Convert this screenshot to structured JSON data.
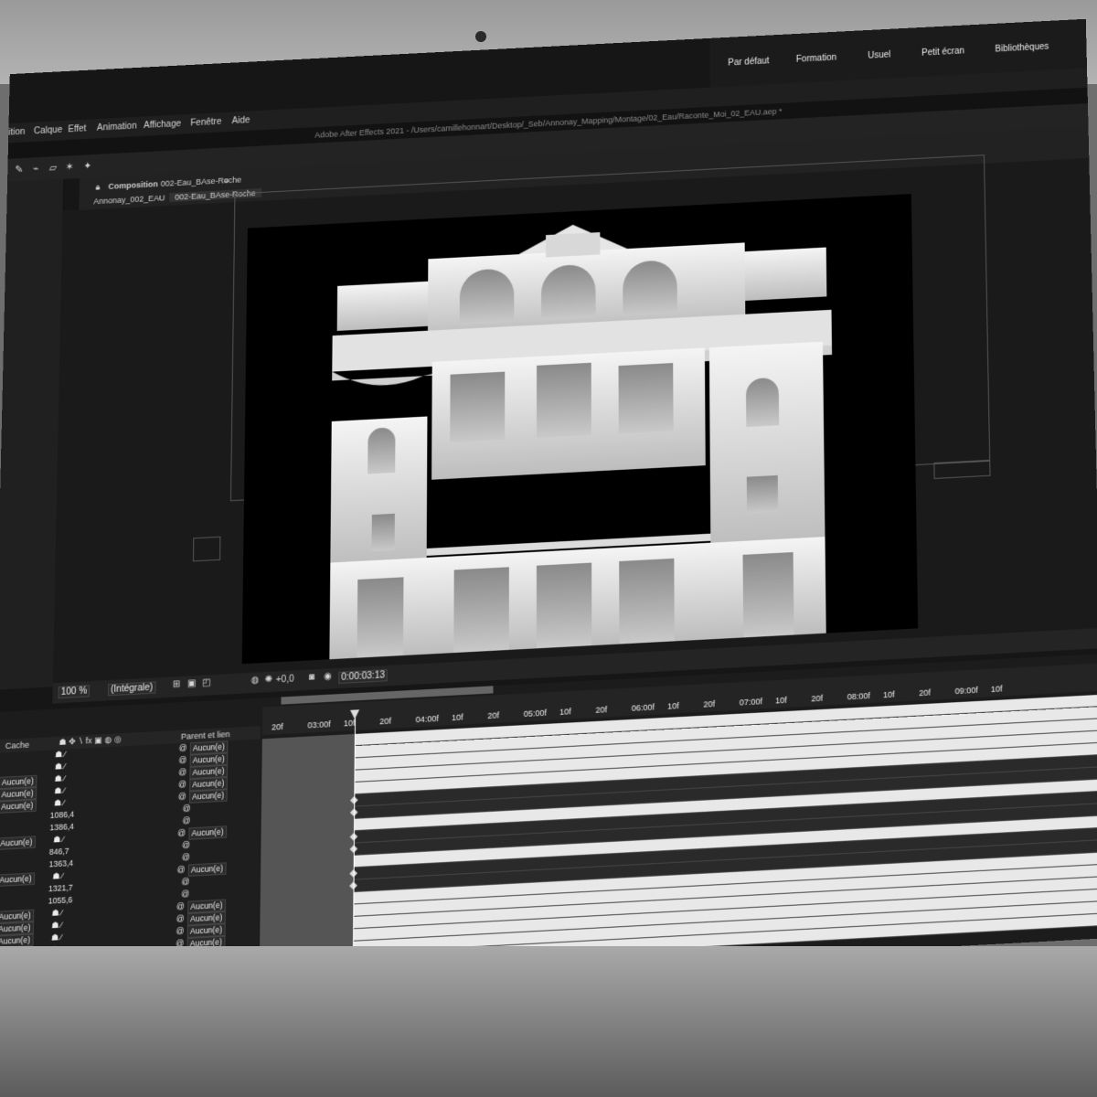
{
  "menu": [
    "ition",
    "Calque",
    "Effet",
    "Animation",
    "Affichage",
    "Fenêtre",
    "Aide"
  ],
  "window_title": "Adobe After Effects 2021 - /Users/camillehonnart/Desktop/_Seb/Annonay_Mapping/Montage/02_Eau/Raconte_Moi_02_EAU.aep *",
  "workspaces": [
    "Par défaut",
    "Formation",
    "Usuel",
    "Petit écran",
    "Bibliothèques"
  ],
  "composition": {
    "tab_label": "Composition",
    "tab_name": "002-Eau_BAse-Roche",
    "breadcrumb_parent": "Annonay_002_EAU",
    "breadcrumb_child": "002-Eau_BAse-Roche"
  },
  "viewer_bar": {
    "zoom": "100 %",
    "resolution": "(Intégrale)",
    "exposure": "+0,0",
    "timecode": "0:00:03:13"
  },
  "timeline": {
    "header_cache": "Cache",
    "header_parent": "Parent et lien",
    "ruler": [
      "20f",
      "03:00f",
      "10f",
      "20f",
      "04:00f",
      "10f",
      "20f",
      "05:00f",
      "10f",
      "20f",
      "06:00f",
      "10f",
      "20f",
      "07:00f",
      "10f",
      "20f",
      "08:00f",
      "10f",
      "20f",
      "09:00f",
      "10f"
    ],
    "rows": [
      {
        "mode": "",
        "parent": "Aucun(e)"
      },
      {
        "mode": "",
        "parent": "Aucun(e)"
      },
      {
        "mode": "Aucun(e)",
        "parent": "Aucun(e)"
      },
      {
        "mode": "Aucun(e)",
        "parent": "Aucun(e)"
      },
      {
        "mode": "Aucun(e)",
        "parent": "Aucun(e)"
      },
      {
        "value": "1086,4"
      },
      {
        "value": "1386,4"
      },
      {
        "mode": "Aucun(e)",
        "parent": "Aucun(e)"
      },
      {
        "value": "846,7"
      },
      {
        "value": "1363,4"
      },
      {
        "mode": "Aucun(e)",
        "parent": "Aucun(e)"
      },
      {
        "value": "1321,7"
      },
      {
        "value": "1055,6"
      },
      {
        "mode": "Aucun(e)",
        "parent": "Aucun(e)"
      },
      {
        "mode": "Aucun(e)",
        "parent": "Aucun(e)"
      },
      {
        "mode": "Aucun(e)",
        "parent": "Aucun(e)"
      },
      {
        "mode": "Aucun(e)",
        "parent": "Aucun(e)"
      },
      {
        "mode": "Aucun(e)",
        "parent": "Aucun(e)"
      },
      {
        "mode": "Aucun(e)",
        "parent": "Aucun(e)"
      }
    ]
  },
  "colors": {
    "ui_dark": "#1c1c1c",
    "accent": "#ffffff",
    "layer_bar": "#e8e8e8"
  }
}
